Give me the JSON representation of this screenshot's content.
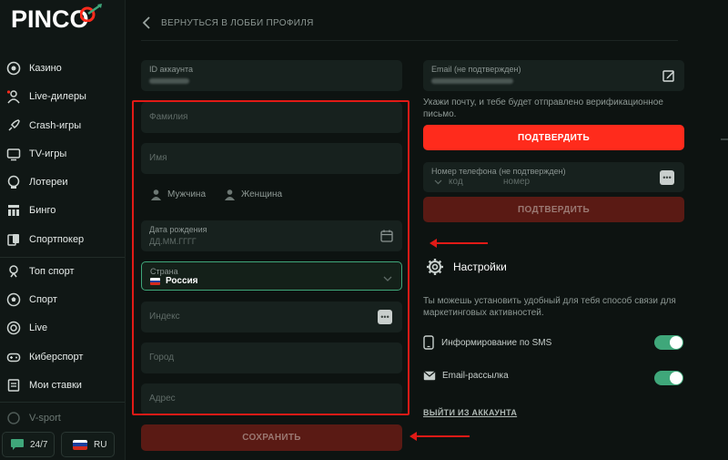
{
  "brand": {
    "logo_text": "PINCO"
  },
  "sidebar": {
    "items": [
      {
        "label": "Казино",
        "icon": "casino-icon"
      },
      {
        "label": "Live-дилеры",
        "icon": "live-dealer-icon"
      },
      {
        "label": "Crash-игры",
        "icon": "rocket-icon"
      },
      {
        "label": "TV-игры",
        "icon": "tv-icon"
      },
      {
        "label": "Лотереи",
        "icon": "lottery-icon"
      },
      {
        "label": "Бинго",
        "icon": "bingo-icon"
      },
      {
        "label": "Спортпокер",
        "icon": "cards-icon"
      },
      {
        "label": "Топ спорт",
        "icon": "trophy-icon"
      },
      {
        "label": "Спорт",
        "icon": "ball-icon"
      },
      {
        "label": "Live",
        "icon": "live-icon"
      },
      {
        "label": "Киберспорт",
        "icon": "gamepad-icon"
      },
      {
        "label": "Мои ставки",
        "icon": "bets-icon"
      },
      {
        "label": "V-sport",
        "icon": "vsport-icon"
      }
    ],
    "support_label": "24/7",
    "language_label": "RU"
  },
  "header": {
    "back_label": "ВЕРНУТЬСЯ В ЛОББИ ПРОФИЛЯ"
  },
  "profile_form": {
    "account_id_label": "ID аккаунта",
    "surname_placeholder": "Фамилия",
    "name_placeholder": "Имя",
    "gender_male": "Мужчина",
    "gender_female": "Женщина",
    "birthdate_label": "Дата рождения",
    "birthdate_placeholder": "ДД.ММ.ГГГГ",
    "country_label": "Страна",
    "country_value": "Россия",
    "postcode_placeholder": "Индекс",
    "city_placeholder": "Город",
    "address_placeholder": "Адрес",
    "save_label": "СОХРАНИТЬ"
  },
  "contact": {
    "email_label": "Email (не подтвержден)",
    "email_hint": "Укажи почту, и тебе будет отправлено верификационное письмо.",
    "confirm_email_label": "ПОДТВЕРДИТЬ",
    "phone_label": "Номер телефона (не подтвержден)",
    "phone_code_placeholder": "код",
    "phone_number_placeholder": "номер",
    "confirm_phone_label": "ПОДТВЕРДИТЬ"
  },
  "settings": {
    "title": "Настройки",
    "hint": "Ты можешь установить удобный для тебя способ связи для маркетинговых активностей.",
    "sms_label": "Информирование по SMS",
    "sms_enabled": true,
    "email_label": "Email-рассылка",
    "email_enabled": true,
    "logout_label": "ВЫЙТИ ИЗ АККАУНТА"
  },
  "colors": {
    "accent_red": "#ff2b1c",
    "toggle_green": "#3fa77a",
    "highlight_red": "#e11a16"
  }
}
